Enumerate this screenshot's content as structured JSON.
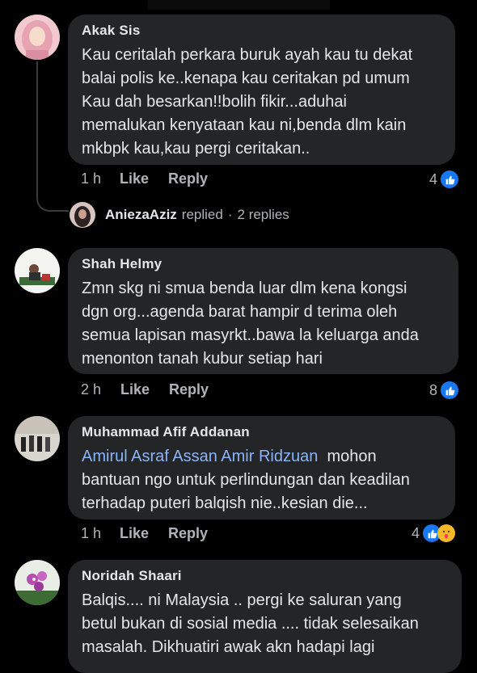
{
  "comments": [
    {
      "author": "Akak Sis",
      "lines": [
        "Kau ceritalah perkara buruk ayah kau tu dekat",
        "balai polis ke..kenapa kau ceritakan pd umum",
        "Kau dah besarkan!!bolih fikir...aduhai",
        "memalukan kenyataan kau ni,benda dlm kain",
        "mkbpk kau,kau pergi ceritakan.."
      ],
      "time": "1 h",
      "like": "Like",
      "reply": "Reply",
      "reactions": "4"
    },
    {
      "author": "Shah Helmy",
      "lines": [
        "Zmn skg ni smua benda luar dlm kena kongsi",
        "dgn org...agenda barat hampir d terima oleh",
        "semua lapisan masyrkt..bawa la keluarga anda",
        "menonton tanah kubur setiap hari"
      ],
      "time": "2 h",
      "like": "Like",
      "reply": "Reply",
      "reactions": "8"
    },
    {
      "author": "Muhammad Afif Addanan",
      "mention": "Amirul Asraf Assan Amir Ridzuan",
      "first_line_rest": "mohon",
      "lines": [
        "bantuan ngo untuk perlindungan dan keadilan",
        "terhadap puteri balqish nie..kesian die..."
      ],
      "time": "1 h",
      "like": "Like",
      "reply": "Reply",
      "reactions": "4"
    },
    {
      "author": "Noridah Shaari",
      "lines": [
        "Balqis.... ni Malaysia .. pergi ke saluran yang",
        "betul bukan di sosial media .... tidak selesaikan",
        "masalah.  Dikhuatiri awak akn hadapi lagi"
      ]
    }
  ],
  "reply_summary": {
    "author": "AniezaAziz",
    "action": "replied",
    "separator": "·",
    "count": "2 replies"
  },
  "colors": {
    "background": "#000000",
    "bubble": "#242526",
    "text": "#e4e6eb",
    "meta": "#b0b3b8",
    "mention": "#8ab4f8",
    "like_blue": "#1877f2"
  },
  "icons": [
    "like-reaction-icon",
    "care-reaction-icon"
  ]
}
